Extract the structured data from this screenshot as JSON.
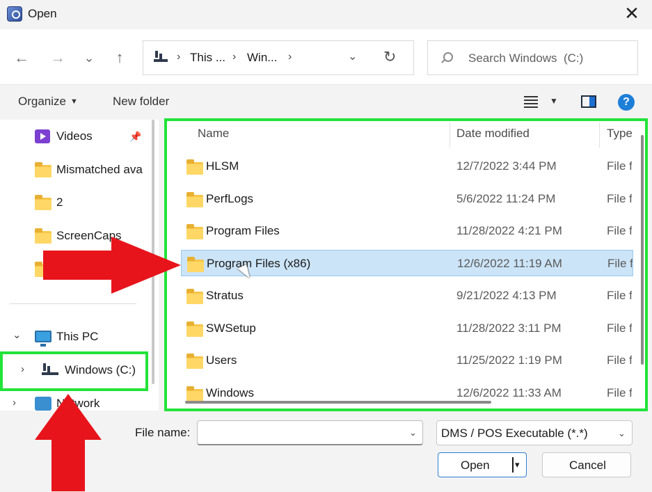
{
  "titlebar": {
    "title": "Open",
    "close_glyph": "✕"
  },
  "nav": {
    "back_glyph": "←",
    "forward_glyph": "→",
    "recent_glyph": "⌄",
    "up_glyph": "↑",
    "breadcrumb": [
      "This ...",
      "Win..."
    ],
    "crumb_sep": "›",
    "dropdown_glyph": "⌄",
    "refresh_glyph": "↻"
  },
  "search": {
    "placeholder": "Search Windows  (C:)"
  },
  "toolbar": {
    "organize_label": "Organize",
    "organize_caret": "▼",
    "new_folder_label": "New folder",
    "view_caret": "▼",
    "help_glyph": "?"
  },
  "sidebar": {
    "pin_glyph": "📌",
    "items": [
      {
        "label": "Videos",
        "icon": "video-icon"
      },
      {
        "label": "Mismatched ava",
        "icon": "folder-icon"
      },
      {
        "label": "2",
        "icon": "folder-icon"
      },
      {
        "label": "ScreenCaps",
        "icon": "folder-icon"
      },
      {
        "label": "",
        "icon": "folder-icon"
      }
    ],
    "this_pc_label": "This PC",
    "windows_label": "Windows  (C:)",
    "network_label": "Network",
    "expanded_glyph": "⌄",
    "collapsed_glyph": "›"
  },
  "filelist": {
    "columns": {
      "name": "Name",
      "date": "Date modified",
      "type": "Type"
    },
    "sort_glyph": "^",
    "rows": [
      {
        "name": "HLSM",
        "date": "12/7/2022 3:44 PM",
        "type": "File f",
        "selected": false
      },
      {
        "name": "PerfLogs",
        "date": "5/6/2022 11:24 PM",
        "type": "File f",
        "selected": false
      },
      {
        "name": "Program Files",
        "date": "11/28/2022 4:21 PM",
        "type": "File f",
        "selected": false
      },
      {
        "name": "Program Files (x86)",
        "date": "12/6/2022 11:19 AM",
        "type": "File f",
        "selected": true
      },
      {
        "name": "Stratus",
        "date": "9/21/2022 4:13 PM",
        "type": "File f",
        "selected": false
      },
      {
        "name": "SWSetup",
        "date": "11/28/2022 3:11 PM",
        "type": "File f",
        "selected": false
      },
      {
        "name": "Users",
        "date": "11/25/2022 1:19 PM",
        "type": "File f",
        "selected": false
      },
      {
        "name": "Windows",
        "date": "12/6/2022 11:33 AM",
        "type": "File f",
        "selected": false
      }
    ]
  },
  "bottom": {
    "file_name_label": "File name:",
    "file_name_value": "",
    "combo_glyph": "⌄",
    "filter_value": "DMS / POS Executable  (*.*)",
    "open_label": "Open",
    "open_dd_glyph": "▾",
    "cancel_label": "Cancel"
  },
  "annotations": {
    "highlight_color": "#22e33a",
    "arrow_color": "#e8141c"
  }
}
